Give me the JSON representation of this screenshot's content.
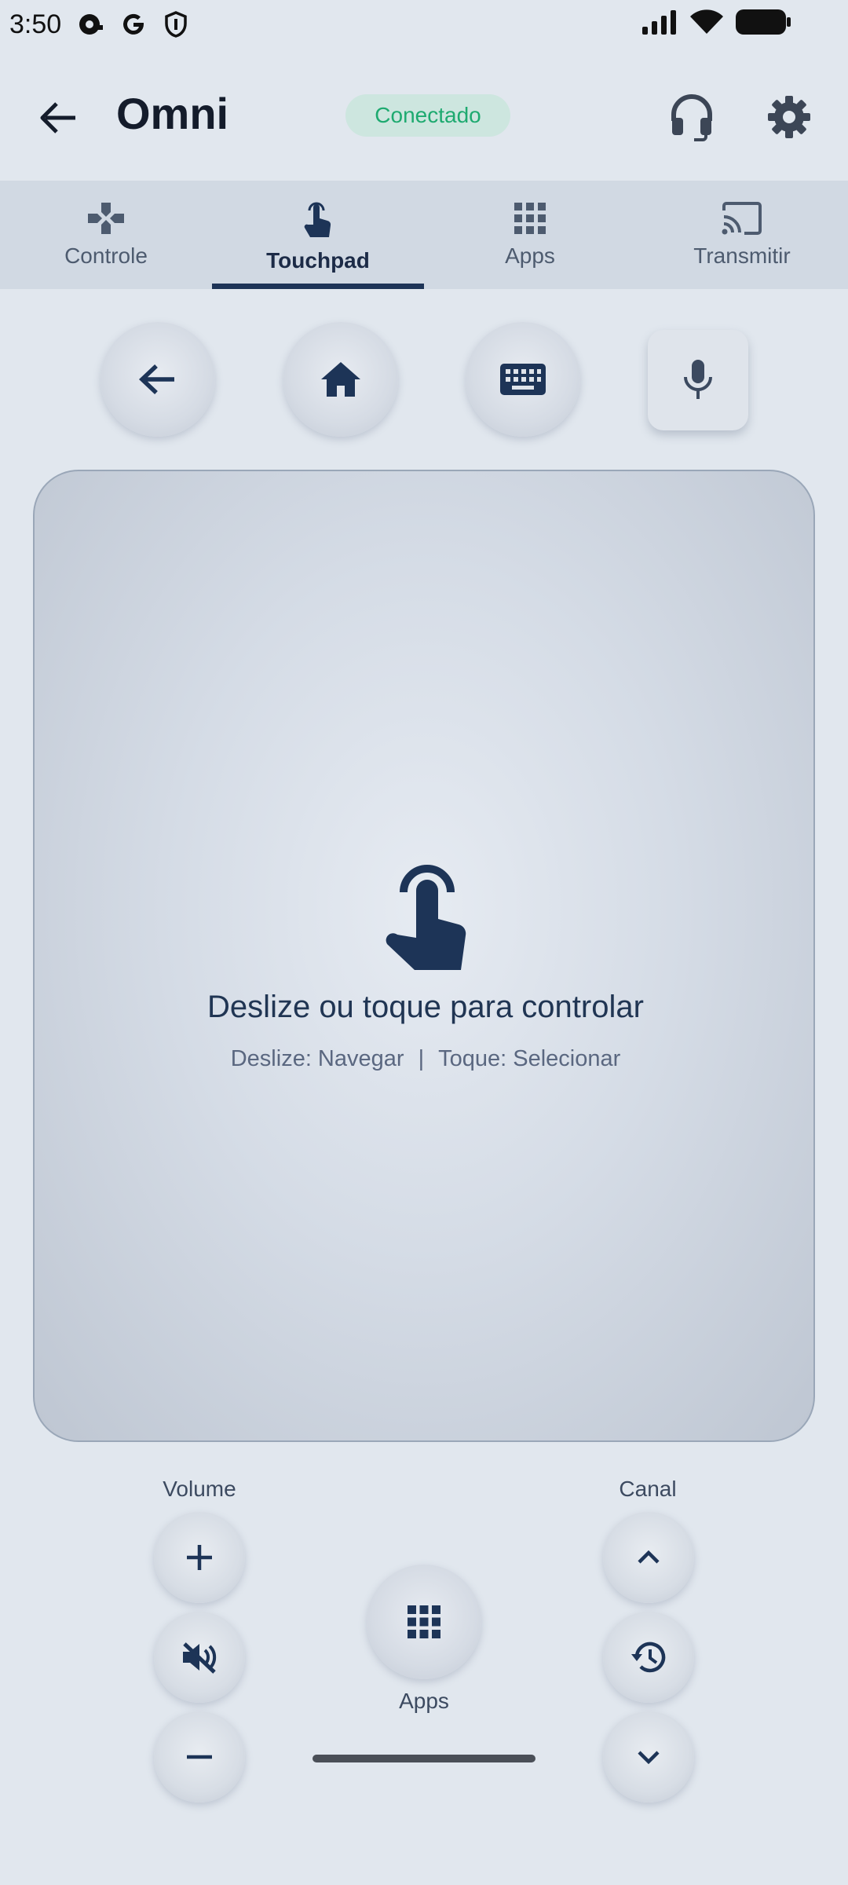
{
  "status_bar": {
    "time": "3:50"
  },
  "header": {
    "title": "Omni",
    "connection_status": "Conectado"
  },
  "tabs": [
    {
      "label": "Controle",
      "icon": "gamepad-icon",
      "active": false
    },
    {
      "label": "Touchpad",
      "icon": "touch-icon",
      "active": true
    },
    {
      "label": "Apps",
      "icon": "apps-grid-icon",
      "active": false
    },
    {
      "label": "Transmitir",
      "icon": "cast-icon",
      "active": false
    }
  ],
  "touchpad": {
    "title": "Deslize ou toque para controlar",
    "hint_swipe": "Deslize: Navegar",
    "hint_separator": "|",
    "hint_tap": "Toque: Selecionar"
  },
  "controls": {
    "volume_label": "Volume",
    "channel_label": "Canal",
    "apps_label": "Apps"
  },
  "colors": {
    "background": "#e1e7ee",
    "accent": "#1d3457",
    "connected": "#1eaa70",
    "connected_bg": "#cde6df"
  }
}
